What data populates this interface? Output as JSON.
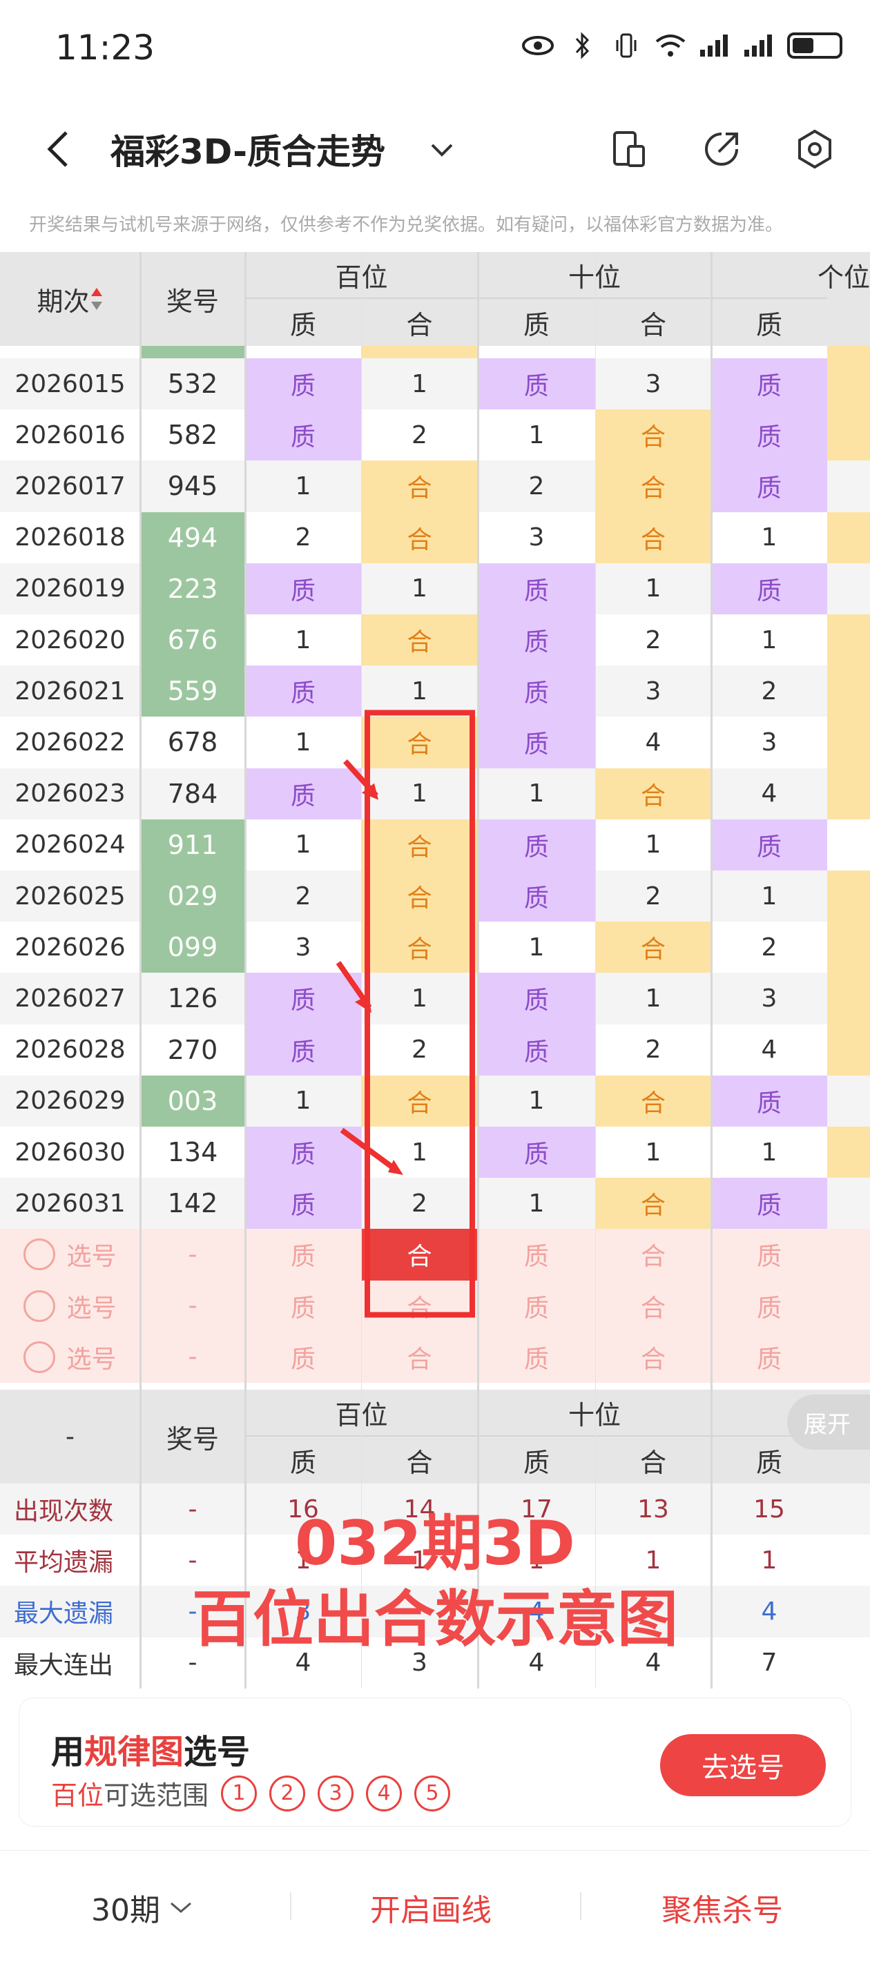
{
  "status": {
    "time": "11:23",
    "battery_level": 0.45
  },
  "header": {
    "title": "福彩3D-质合走势"
  },
  "notice": "开奖结果与试机号来源于网络，仅供参考不作为兑奖依据。如有疑问，以福体彩官方数据为准。",
  "table": {
    "col_period": "期次",
    "col_number": "奖号",
    "groups": [
      "百位",
      "十位",
      "个位"
    ],
    "sub": [
      "质",
      "合",
      "质",
      "合",
      "质"
    ],
    "rows": [
      {
        "period": "2026015",
        "num": "532",
        "green": false,
        "cells": [
          "质",
          "1",
          "质",
          "3",
          "质"
        ]
      },
      {
        "period": "2026016",
        "num": "582",
        "green": false,
        "cells": [
          "质",
          "2",
          "1",
          "合",
          "质"
        ]
      },
      {
        "period": "2026017",
        "num": "945",
        "green": false,
        "cells": [
          "1",
          "合",
          "2",
          "合",
          "质"
        ]
      },
      {
        "period": "2026018",
        "num": "494",
        "green": true,
        "cells": [
          "2",
          "合",
          "3",
          "合",
          "1"
        ]
      },
      {
        "period": "2026019",
        "num": "223",
        "green": true,
        "cells": [
          "质",
          "1",
          "质",
          "1",
          "质"
        ]
      },
      {
        "period": "2026020",
        "num": "676",
        "green": true,
        "cells": [
          "1",
          "合",
          "质",
          "2",
          "1"
        ]
      },
      {
        "period": "2026021",
        "num": "559",
        "green": true,
        "cells": [
          "质",
          "1",
          "质",
          "3",
          "2"
        ]
      },
      {
        "period": "2026022",
        "num": "678",
        "green": false,
        "cells": [
          "1",
          "合",
          "质",
          "4",
          "3"
        ]
      },
      {
        "period": "2026023",
        "num": "784",
        "green": false,
        "cells": [
          "质",
          "1",
          "1",
          "合",
          "4"
        ]
      },
      {
        "period": "2026024",
        "num": "911",
        "green": true,
        "cells": [
          "1",
          "合",
          "质",
          "1",
          "质"
        ]
      },
      {
        "period": "2026025",
        "num": "029",
        "green": true,
        "cells": [
          "2",
          "合",
          "质",
          "2",
          "1"
        ]
      },
      {
        "period": "2026026",
        "num": "099",
        "green": true,
        "cells": [
          "3",
          "合",
          "1",
          "合",
          "2"
        ]
      },
      {
        "period": "2026027",
        "num": "126",
        "green": false,
        "cells": [
          "质",
          "1",
          "质",
          "1",
          "3"
        ]
      },
      {
        "period": "2026028",
        "num": "270",
        "green": false,
        "cells": [
          "质",
          "2",
          "质",
          "2",
          "4"
        ]
      },
      {
        "period": "2026029",
        "num": "003",
        "green": true,
        "cells": [
          "1",
          "合",
          "1",
          "合",
          "质"
        ]
      },
      {
        "period": "2026030",
        "num": "134",
        "green": false,
        "cells": [
          "质",
          "1",
          "质",
          "1",
          "1"
        ]
      },
      {
        "period": "2026031",
        "num": "142",
        "green": false,
        "cells": [
          "质",
          "2",
          "1",
          "合",
          "质"
        ]
      }
    ],
    "pick_rows": [
      {
        "label": "选号",
        "num": "-",
        "cells": [
          "质",
          "合",
          "质",
          "合",
          "质"
        ]
      },
      {
        "label": "选号",
        "num": "-",
        "cells": [
          "质",
          "合",
          "质",
          "合",
          "质"
        ]
      },
      {
        "label": "选号",
        "num": "-",
        "cells": [
          "质",
          "合",
          "质",
          "合",
          "质"
        ]
      }
    ],
    "stats_header": {
      "period": "-",
      "number": "奖号"
    },
    "stats": [
      {
        "label": "出现次数",
        "num": "-",
        "cells": [
          "16",
          "14",
          "17",
          "13",
          "15"
        ]
      },
      {
        "label": "平均遗漏",
        "num": "-",
        "cells": [
          "1",
          "1",
          "1",
          "1",
          "1"
        ]
      },
      {
        "label": "最大遗漏",
        "num": "-",
        "cells": [
          "3",
          "",
          "4",
          "",
          "4"
        ]
      },
      {
        "label": "最大连出",
        "num": "-",
        "cells": [
          "4",
          "3",
          "4",
          "4",
          "7"
        ]
      }
    ]
  },
  "overlay": {
    "line1": "032期3D",
    "line2": "百位出合数示意图"
  },
  "expand_label": "展开",
  "pick_card": {
    "title_prefix": "用",
    "title_red": "规律图",
    "title_suffix": "选号",
    "range_red": "百位",
    "range_text": "可选范围",
    "options": [
      "1",
      "2",
      "3",
      "4",
      "5"
    ],
    "go_button": "去选号"
  },
  "bottom_bar": {
    "periods": "30期",
    "draw_lines": "开启画线",
    "focus_kill": "聚焦杀号"
  }
}
